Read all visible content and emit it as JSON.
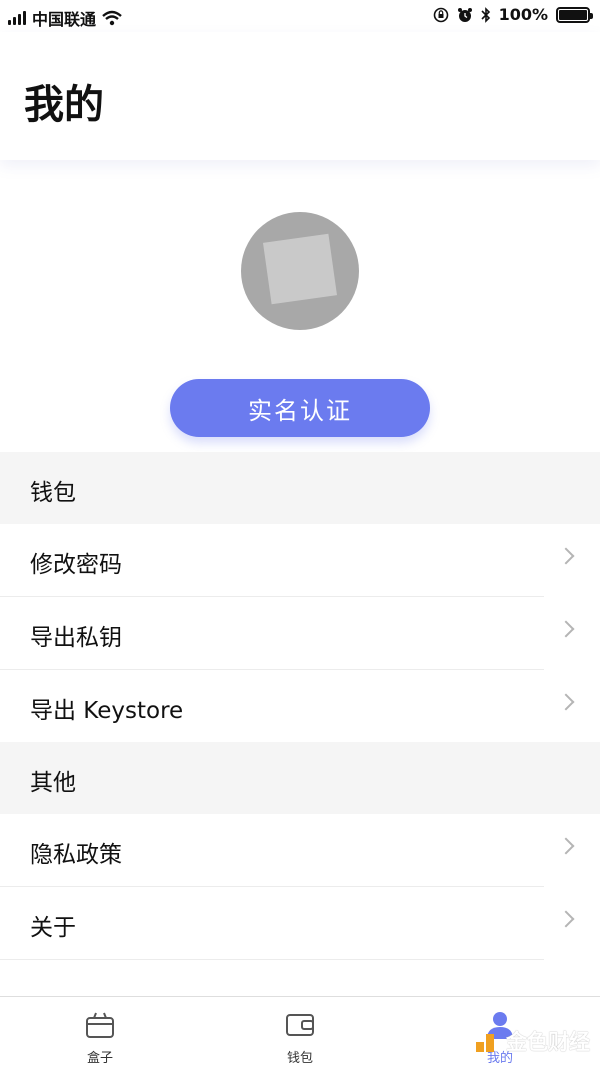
{
  "status_bar": {
    "carrier": "中国联通",
    "battery": "100%",
    "battery_level": 1.0
  },
  "header": {
    "title": "我的"
  },
  "profile": {
    "verify_button": "实名认证"
  },
  "sections": {
    "wallet": {
      "title": "钱包",
      "items": [
        {
          "label": "修改密码"
        },
        {
          "label": "导出私钥"
        },
        {
          "label": "导出 Keystore"
        }
      ]
    },
    "other": {
      "title": "其他",
      "items": [
        {
          "label": "隐私政策"
        },
        {
          "label": "关于"
        }
      ]
    }
  },
  "tabbar": {
    "tabs": [
      {
        "label": "盒子",
        "icon": "box-icon"
      },
      {
        "label": "钱包",
        "icon": "wallet-icon"
      },
      {
        "label": "我的",
        "icon": "person-icon",
        "active": true
      }
    ]
  },
  "watermark": {
    "text": "金色财经"
  },
  "colors": {
    "accent": "#6b7bef",
    "section_bg": "#f5f5f5",
    "chevron": "#b5b5b5"
  }
}
